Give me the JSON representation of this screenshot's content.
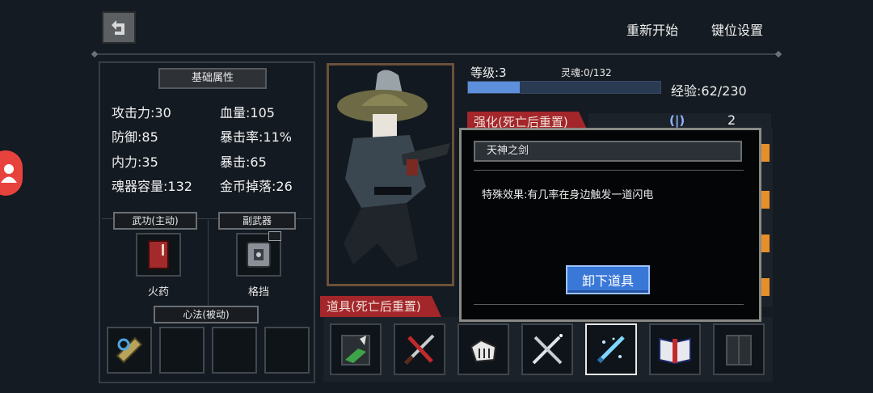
{
  "header": {
    "restart_label": "重新开始",
    "keybind_label": "键位设置"
  },
  "left_panel": {
    "title": "基础属性",
    "stats": [
      {
        "label": "攻击力:30"
      },
      {
        "label": "血量:105"
      },
      {
        "label": "防御:85"
      },
      {
        "label": "暴击率:11%"
      },
      {
        "label": "内力:35"
      },
      {
        "label": "暴击:65"
      },
      {
        "label": "魂器容量:132"
      },
      {
        "label": "金币掉落:26"
      }
    ],
    "martial_title": "武功(主动)",
    "sub_weapon_title": "副武器",
    "martial_item": "火药",
    "sub_weapon_item": "格挡",
    "passive_title": "心法(被动)"
  },
  "status": {
    "level": "等级:3",
    "soul": "灵魂:0/132",
    "exp": "经验:62/230",
    "exp_fraction": 0.27
  },
  "enhance": {
    "tab_label": "强化(死亡后重置)",
    "count": "2"
  },
  "items": {
    "tab_label": "道具(死亡后重置)"
  },
  "popup": {
    "item_name": "天神之剑",
    "description": "特殊效果:有几率在身边触发一道闪电",
    "unequip_label": "卸下道具"
  },
  "colors": {
    "background": "#141b22",
    "accent_red": "#a3262b",
    "accent_blue": "#3a78d8",
    "exp_bar": "#5d8fdc"
  }
}
